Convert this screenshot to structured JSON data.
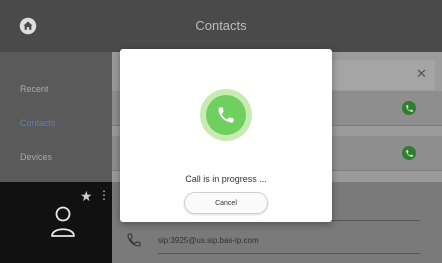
{
  "header": {
    "title": "Contacts",
    "home_icon": "home-icon"
  },
  "sidebar": {
    "items": [
      {
        "label": "Recent",
        "active": false
      },
      {
        "label": "Contacts",
        "active": true
      },
      {
        "label": "Devices",
        "active": false
      }
    ]
  },
  "contacts": {
    "search_value": "",
    "rows": [
      {
        "call_icon": "phone-icon"
      },
      {
        "call_icon": "phone-icon"
      }
    ]
  },
  "profile": {
    "avatar_icon": "user-icon",
    "favorite_icon": "star-icon",
    "menu_icon": "kebab-icon"
  },
  "detail": {
    "sip_address": "sip:3925@us.sip.bas-ip.com"
  },
  "modal": {
    "status_text": "Call is in progress ...",
    "cancel_label": "Cancel",
    "icon": "phone-icon"
  },
  "colors": {
    "accent_green": "#6fcf5f",
    "accent_green_light": "#c8ebb4",
    "active_nav": "#5b7fb8",
    "call_green": "#2f7d2f"
  }
}
